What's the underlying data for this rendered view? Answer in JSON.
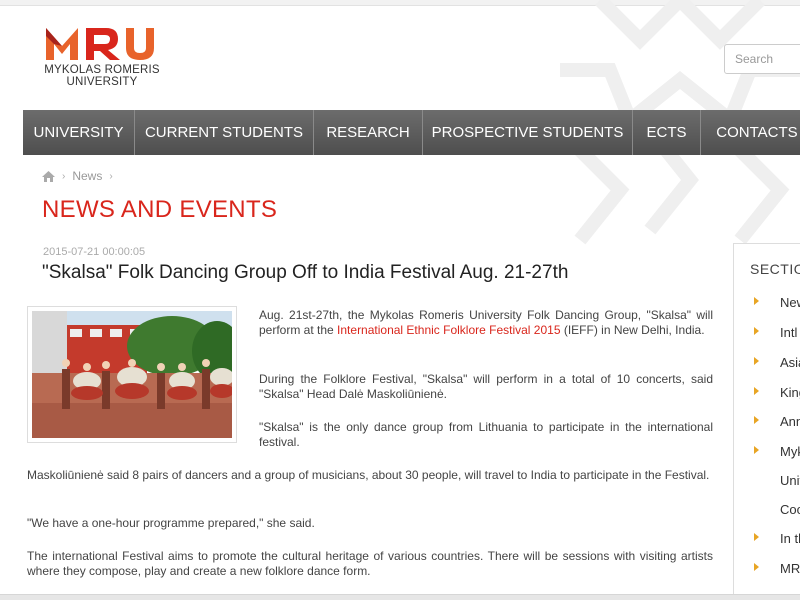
{
  "logo": {
    "line1": "MYKOLAS ROMERIS",
    "line2": "UNIVERSITY",
    "colors": {
      "orange": "#e8632b",
      "red": "#d9261c",
      "darkred": "#a8231c"
    }
  },
  "search": {
    "placeholder": "Search"
  },
  "nav": {
    "items": [
      {
        "label": "UNIVERSITY"
      },
      {
        "label": "CURRENT STUDENTS"
      },
      {
        "label": "RESEARCH"
      },
      {
        "label": "PROSPECTIVE STUDENTS"
      },
      {
        "label": "ECTS"
      },
      {
        "label": "CONTACTS"
      }
    ]
  },
  "breadcrumb": {
    "home_icon": "home-icon",
    "current": "News"
  },
  "page_title": "NEWS AND EVENTS",
  "article": {
    "date": "2015-07-21 00:00:05",
    "title": "\"Skalsa\" Folk Dancing Group Off to India Festival Aug. 21-27th",
    "p1_before": "Aug. 21st-27th, the Mykolas Romeris University Folk Dancing Group, \"Skalsa\" will perform at the ",
    "p1_link": "International Ethnic Folklore Festival 2015",
    "p1_after": " (IEFF) in New Delhi, India.",
    "p2": "During the Folklore Festival, \"Skalsa\" will perform in a total of 10 concerts, said \"Skalsa\" Head Dalė Maskoliūnienė.",
    "p3": "\"Skalsa\" is the only dance group from Lithuania to participate in the international festival.",
    "p4": "Maskoliūnienė said 8 pairs of dancers and a group of musicians, about 30 people, will travel to India to participate in the Festival.",
    "p5": "\"We have a one-hour programme prepared,\" she said.",
    "p6": "The international Festival aims to promote the cultural heritage of various countries. There will be sessions with visiting artists where they compose, play and create a new folklore dance form."
  },
  "sidebar": {
    "title": "SECTIONS",
    "items": [
      {
        "label": "News",
        "arrow": true
      },
      {
        "label": "Intl",
        "arrow": true
      },
      {
        "label": "Asia",
        "arrow": true
      },
      {
        "label": "King",
        "arrow": true
      },
      {
        "label": "Ann",
        "arrow": true
      },
      {
        "label": "Myk",
        "arrow": true
      },
      {
        "label": "Univ",
        "arrow": false
      },
      {
        "label": "Coo",
        "arrow": false
      },
      {
        "label": "In th",
        "arrow": true
      },
      {
        "label": "MRU",
        "arrow": true
      }
    ]
  }
}
